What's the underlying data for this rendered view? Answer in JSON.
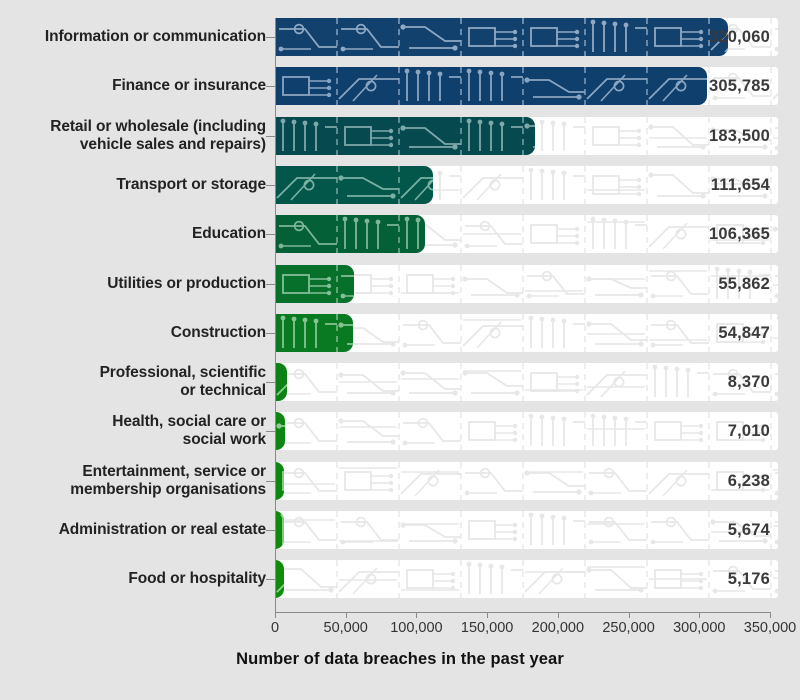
{
  "chart_data": {
    "type": "bar",
    "orientation": "horizontal",
    "title": "",
    "xlabel": "Number of data breaches in the past year",
    "ylabel": "",
    "xlim": [
      0,
      350000
    ],
    "xticks": [
      0,
      50000,
      100000,
      150000,
      200000,
      250000,
      300000,
      350000
    ],
    "xtick_labels": [
      "0",
      "50,000",
      "100,000",
      "150,000",
      "200,000",
      "250,000",
      "300,000",
      "350,000"
    ],
    "grid": false,
    "legend": "none",
    "categories": [
      "Information or communication",
      "Finance or insurance",
      "Retail or wholesale (including vehicle sales and repairs)",
      "Transport or storage",
      "Education",
      "Utilities or production",
      "Construction",
      "Professional, scientific or technical",
      "Health, social care or social work",
      "Entertainment, service or membership organisations",
      "Administration or real estate",
      "Food or hospitality"
    ],
    "values": [
      320060,
      305785,
      183500,
      111654,
      106365,
      55862,
      54847,
      8370,
      7010,
      6238,
      5674,
      5176
    ],
    "value_labels": [
      "320,060",
      "305,785",
      "183,500",
      "111,654",
      "106,365",
      "55,862",
      "54,847",
      "8,370",
      "7,010",
      "6,238",
      "5,674",
      "5,176"
    ]
  },
  "bars": [
    {
      "label_lines": [
        "Information or communication"
      ],
      "value": 320060,
      "value_label": "320,060",
      "color": "#12416e",
      "trace": "#8fa9c4"
    },
    {
      "label_lines": [
        "Finance or insurance"
      ],
      "value": 305785,
      "value_label": "305,785",
      "color": "#0e3f6d",
      "trace": "#8aa5c1"
    },
    {
      "label_lines": [
        "Retail or wholesale (including",
        "vehicle sales and repairs)"
      ],
      "value": 183500,
      "value_label": "183,500",
      "color": "#064a50",
      "trace": "#7fa8ab"
    },
    {
      "label_lines": [
        "Transport or storage"
      ],
      "value": 111654,
      "value_label": "111,654",
      "color": "#03574a",
      "trace": "#7cb0a4"
    },
    {
      "label_lines": [
        "Education"
      ],
      "value": 106365,
      "value_label": "106,365",
      "color": "#046137",
      "trace": "#7fb598"
    },
    {
      "label_lines": [
        "Utilities or production"
      ],
      "value": 55862,
      "value_label": "55,862",
      "color": "#07702b",
      "trace": "#84bf97"
    },
    {
      "label_lines": [
        "Construction"
      ],
      "value": 54847,
      "value_label": "54,847",
      "color": "#0a7a22",
      "trace": "#87c492"
    },
    {
      "label_lines": [
        "Professional, scientific",
        "or technical"
      ],
      "value": 8370,
      "value_label": "8,370",
      "color": "#0c8116",
      "trace": "#8ccb90"
    },
    {
      "label_lines": [
        "Health, social care or",
        "social work"
      ],
      "value": 7010,
      "value_label": "7,010",
      "color": "#0d8512",
      "trace": "#8ecd8f"
    },
    {
      "label_lines": [
        "Entertainment, service or",
        "membership organisations"
      ],
      "value": 6238,
      "value_label": "6,238",
      "color": "#0d880f",
      "trace": "#90cf90"
    },
    {
      "label_lines": [
        "Administration or real estate"
      ],
      "value": 5674,
      "value_label": "5,674",
      "color": "#0e8a0c",
      "trace": "#91d08f"
    },
    {
      "label_lines": [
        "Food or hospitality"
      ],
      "value": 5176,
      "value_label": "5,176",
      "color": "#0e8c0a",
      "trace": "#92d18f"
    }
  ],
  "axis": {
    "title": "Number of data breaches in the past year",
    "ticks": [
      "0",
      "50,000",
      "100,000",
      "150,000",
      "200,000",
      "250,000",
      "300,000",
      "350,000"
    ]
  },
  "colors": {
    "background": "#e4e4e4",
    "track": "#ffffff",
    "track_trace": "#e7e7e7",
    "axis": "#8a8a8a",
    "label_text": "#222222",
    "value_text": "#3a3a3a"
  }
}
